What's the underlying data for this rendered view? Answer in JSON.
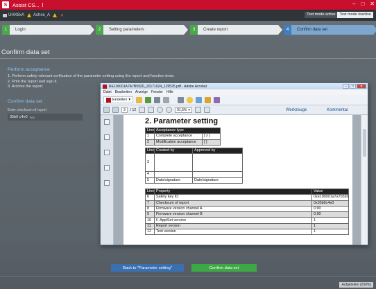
{
  "app": {
    "title": "Assist CS..."
  },
  "crumbs": {
    "project": "UHX8xA",
    "device": "Achse_A"
  },
  "mode": {
    "active_label": "Test mode active",
    "inactive_label": "Test mode inactive"
  },
  "steps": [
    {
      "num": "1",
      "label": "Login"
    },
    {
      "num": "2",
      "label": "Setting parameters"
    },
    {
      "num": "3",
      "label": "Create report"
    },
    {
      "num": "4",
      "label": "Confirm data set"
    }
  ],
  "page": {
    "title": "Confirm data set"
  },
  "perform": {
    "heading": "Perform acceptance",
    "lines": [
      "1. Perform safety-relevant verification of the parameter setting using the report and function tests.",
      "2. Print the report and sign it.",
      "3. Archive the report."
    ]
  },
  "confirm": {
    "heading": "Confirm data set",
    "label": "Enter checksum of report",
    "value": "35b9 c4e0",
    "suffix": "hex"
  },
  "buttons": {
    "back": "Back to \"Parameter setting\"",
    "confirm": "Confirm data set"
  },
  "status": {
    "right": "Aufgeteilen (200%)"
  },
  "acrobat": {
    "title": "RE100001A7A7B592D_20171024_125525.pdf - Adobe Acrobat",
    "menu": [
      "Datei",
      "Bearbeiten",
      "Anzeige",
      "Fenster",
      "Hilfe"
    ],
    "create_label": "Erstellen",
    "page_current": "3",
    "page_total": "/ 12",
    "zoom": "91,6%",
    "panel_tools": "Werkzeuge",
    "panel_comment": "Kommentar",
    "doc": {
      "heading": "2. Parameter setting",
      "table1": {
        "headers": [
          "Line",
          "Acceptance type"
        ],
        "rows": [
          [
            "1",
            "Complete acceptance",
            "[ x ]"
          ],
          [
            "2",
            "Modification acceptance",
            "[ ]"
          ]
        ]
      },
      "table2": {
        "headers": [
          "Line",
          "Created by",
          "Approved by"
        ],
        "rows": [
          [
            "3",
            "",
            ""
          ],
          [
            "4",
            "",
            ""
          ],
          [
            "5",
            "Date/signature",
            "Date/signature"
          ]
        ]
      },
      "table3": {
        "headers": [
          "Line",
          "Property",
          "Value"
        ],
        "rows": [
          [
            "6",
            "Safety key ID",
            "0xe100001a7a7b592d"
          ],
          [
            "7",
            "Checksum of report",
            "0x35b9c4e0"
          ],
          [
            "8",
            "Firmware version channel A",
            "0.90"
          ],
          [
            "9",
            "Firmware version channel B",
            "0.90"
          ],
          [
            "10",
            "F-ApplSet version",
            "1"
          ],
          [
            "11",
            "Report version",
            "1"
          ],
          [
            "12",
            "Text version",
            "1"
          ]
        ]
      }
    }
  }
}
